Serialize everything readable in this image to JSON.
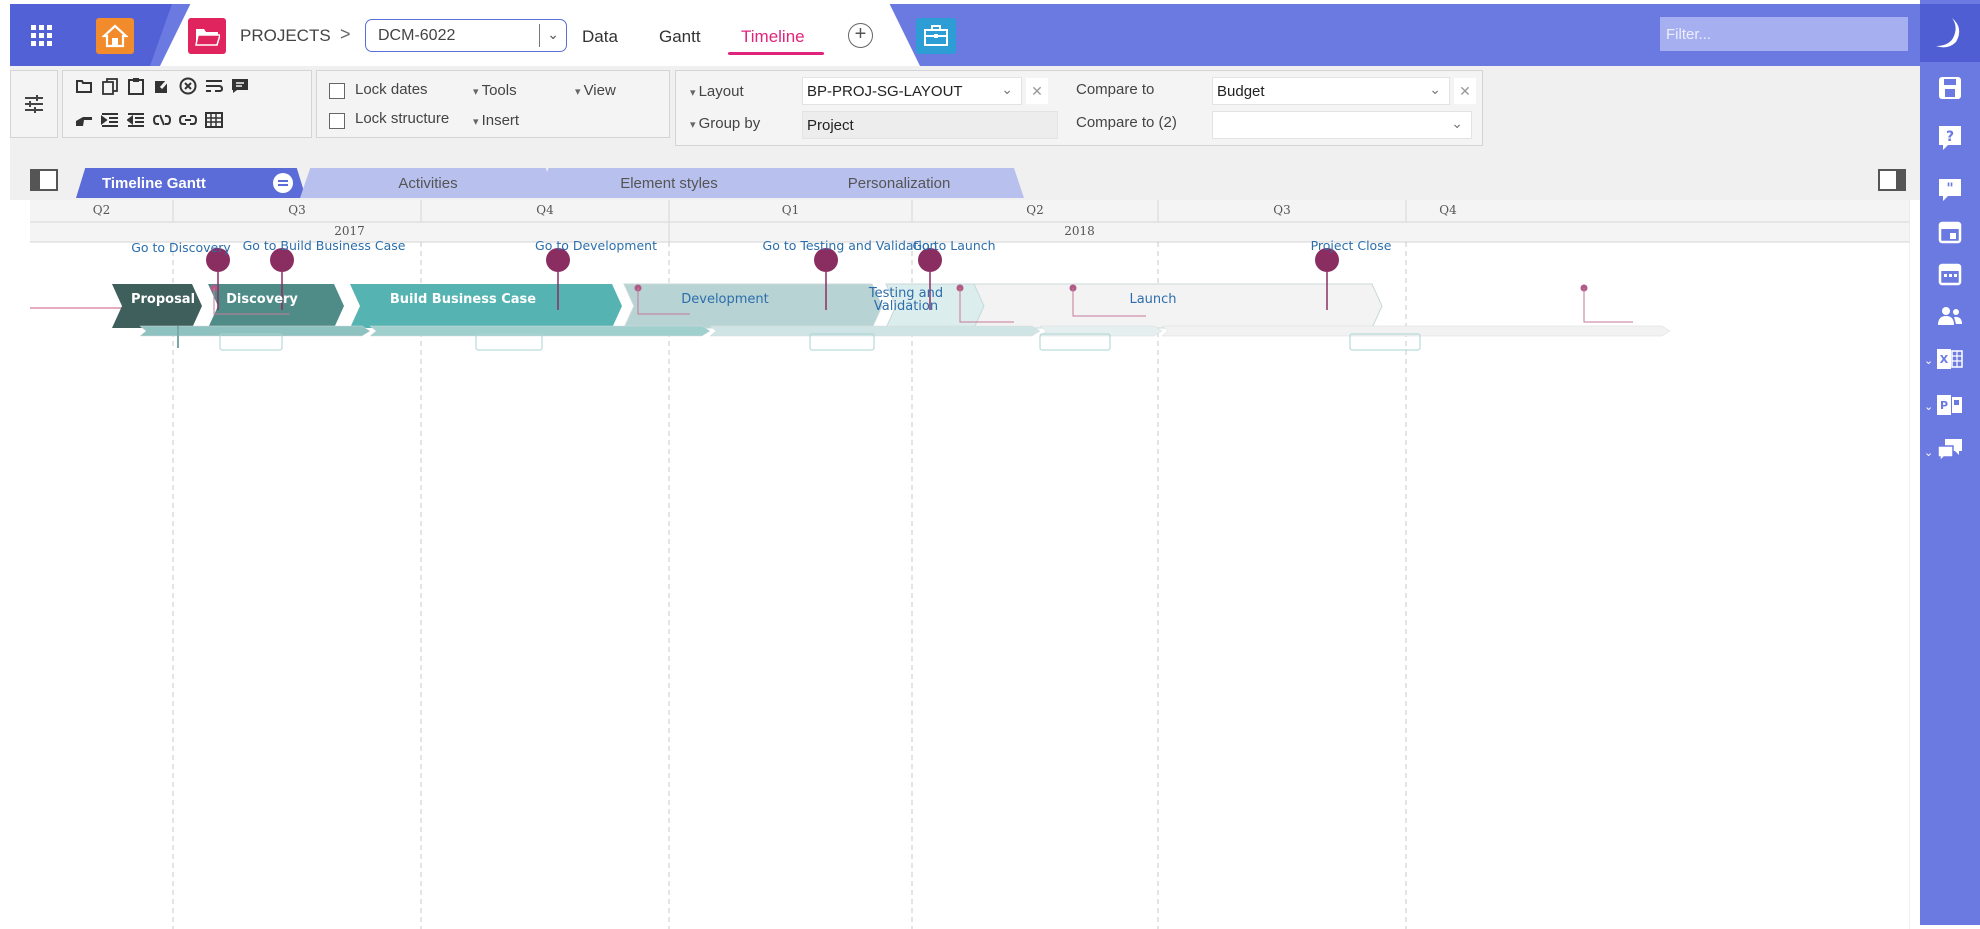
{
  "header": {
    "breadcrumb": "PROJECTS",
    "breadcrumb_sep": ">",
    "project_value": "DCM-6022",
    "tabs": [
      "Data",
      "Gantt",
      "Timeline"
    ],
    "active_tab": "Timeline",
    "filter_placeholder": "Filter..."
  },
  "toolbar": {
    "lock_dates": "Lock dates",
    "lock_structure": "Lock structure",
    "tools": "Tools",
    "insert": "Insert",
    "view": "View",
    "layout_label": "Layout",
    "layout_value": "BP-PROJ-SG-LAYOUT",
    "group_by_label": "Group by",
    "group_by_value": "Project",
    "compare_label": "Compare to",
    "compare_value": "Budget",
    "compare2_label": "Compare to (2)",
    "compare2_value": ""
  },
  "subtabs": [
    "Timeline Gantt",
    "Activities",
    "Element styles",
    "Personalization"
  ],
  "scale": {
    "quarters": [
      "Q2",
      "Q3",
      "Q4",
      "Q1",
      "Q2",
      "Q3",
      "Q4"
    ],
    "years": [
      "2017",
      "2018"
    ]
  },
  "milestones": [
    "Go to Discovery",
    "Go to Build Business Case",
    "Go to Development",
    "Go to Testing and Validation",
    "Go to Launch",
    "Project Close"
  ],
  "phases": [
    {
      "label": "Proposal",
      "color": "#3e5f5c"
    },
    {
      "label": "Discovery",
      "color": "#4f8c88"
    },
    {
      "label": "Build Business Case",
      "color": "#55b4b2"
    },
    {
      "label": "Development",
      "color": "#b7d3d3"
    },
    {
      "label": "Testing and",
      "label2": "Validation",
      "color": "#dceded"
    },
    {
      "label": "Launch",
      "color": "#f3f3f3"
    }
  ],
  "colors": {
    "accent": "#6a7ae0",
    "active_tab": "#e0247c",
    "milestone": "#8a2e62",
    "label_blue": "#2c6eac"
  },
  "icons": {
    "apps": "apps-grid-icon",
    "home": "home-icon",
    "projects": "folder-icon",
    "add_view": "plus-circle-icon",
    "toolbox": "briefcase-icon",
    "sidebar": [
      "logo-moon-icon",
      "save-icon",
      "help-icon",
      "quote-icon",
      "calendar-icon",
      "calendar-alt-icon",
      "people-icon",
      "excel-icon",
      "powerpoint-icon",
      "chat-icon"
    ]
  }
}
